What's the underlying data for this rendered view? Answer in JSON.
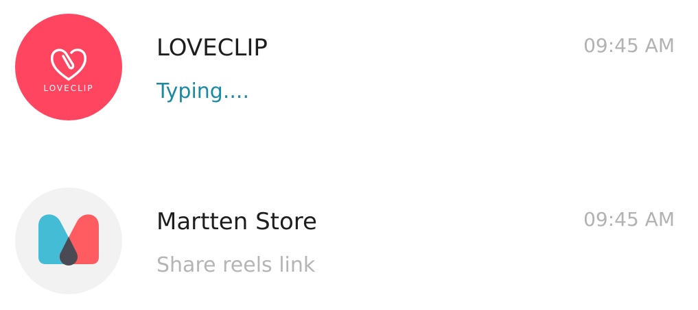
{
  "chats": [
    {
      "name": "LOVECLIP",
      "preview": "Typing....",
      "time": "09:45 AM",
      "avatar_text": "LOVECLIP",
      "avatar_color": "#ff4560",
      "avatar_icon": "heart-clip-icon",
      "preview_color": "#1a8aa3"
    },
    {
      "name": "Martten Store",
      "preview": "Share reels link",
      "time": "09:45 AM",
      "avatar_color": "#f2f2f2",
      "avatar_icon": "m-logo-icon",
      "preview_color": "#b5b5b5"
    }
  ]
}
